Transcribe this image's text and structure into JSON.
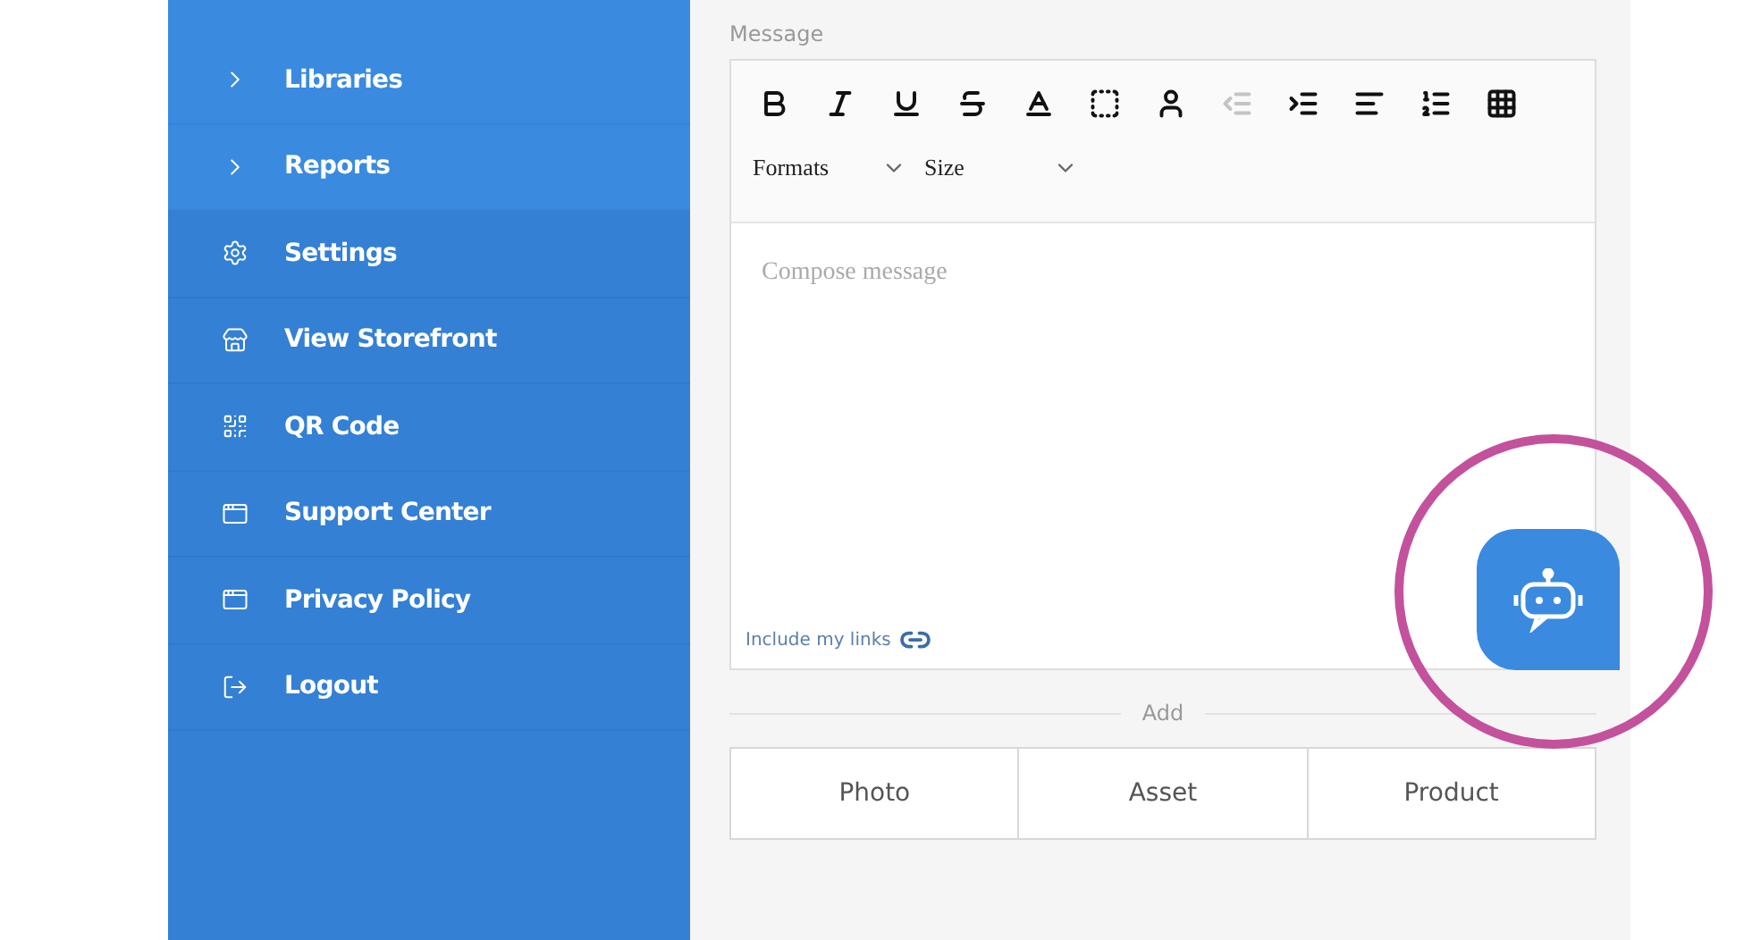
{
  "sidebar": {
    "subitems": [
      {
        "label": "Libraries",
        "kind": "chevron"
      },
      {
        "label": "Reports",
        "kind": "chevron"
      }
    ],
    "items": [
      {
        "label": "Settings",
        "kind": "gear"
      },
      {
        "label": "View Storefront",
        "kind": "store"
      },
      {
        "label": "QR Code",
        "kind": "qr"
      },
      {
        "label": "Support Center",
        "kind": "window"
      },
      {
        "label": "Privacy Policy",
        "kind": "window"
      },
      {
        "label": "Logout",
        "kind": "logout"
      }
    ]
  },
  "message": {
    "label": "Message",
    "toolbar": [
      {
        "kind": "bold",
        "disabled": false
      },
      {
        "kind": "italic",
        "disabled": false
      },
      {
        "kind": "underline",
        "disabled": false
      },
      {
        "kind": "strike",
        "disabled": false
      },
      {
        "kind": "color",
        "disabled": false
      },
      {
        "kind": "background",
        "disabled": false
      },
      {
        "kind": "person",
        "disabled": false
      },
      {
        "kind": "outdent",
        "disabled": true
      },
      {
        "kind": "indent",
        "disabled": false
      },
      {
        "kind": "align",
        "disabled": false
      },
      {
        "kind": "list",
        "disabled": false
      },
      {
        "kind": "table",
        "disabled": false
      }
    ],
    "dropdowns": [
      "Formats",
      "Size"
    ],
    "placeholder": "Compose message",
    "links_label": "Include my links"
  },
  "add": {
    "label": "Add",
    "buttons": [
      "Photo",
      "Asset",
      "Product"
    ]
  }
}
